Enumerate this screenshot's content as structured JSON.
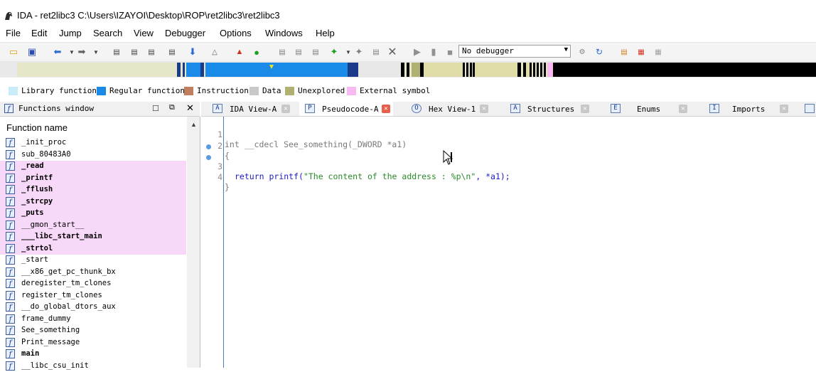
{
  "window": {
    "title": "IDA - ret2libc3 C:\\Users\\IZAYOI\\Desktop\\ROP\\ret2libc3\\ret2libc3"
  },
  "menu": [
    "File",
    "Edit",
    "Jump",
    "Search",
    "View",
    "Debugger",
    "Options",
    "Windows",
    "Help"
  ],
  "toolbar": {
    "debugger": "No debugger"
  },
  "legend": [
    {
      "label": "Library function",
      "color": "#c8ecf8"
    },
    {
      "label": "Regular function",
      "color": "#1a8ae8"
    },
    {
      "label": "Instruction",
      "color": "#c08060"
    },
    {
      "label": "Data",
      "color": "#c8c8c8"
    },
    {
      "label": "Unexplored",
      "color": "#b0b070"
    },
    {
      "label": "External symbol",
      "color": "#f8b8f0"
    }
  ],
  "functions_window": {
    "title": "Functions window",
    "column_header": "Function name",
    "items": [
      {
        "name": "_init_proc",
        "bold": false,
        "external": false
      },
      {
        "name": "sub_80483A0",
        "bold": false,
        "external": false
      },
      {
        "name": "_read",
        "bold": true,
        "external": true
      },
      {
        "name": "_printf",
        "bold": true,
        "external": true
      },
      {
        "name": "_fflush",
        "bold": true,
        "external": true
      },
      {
        "name": "_strcpy",
        "bold": true,
        "external": true
      },
      {
        "name": "_puts",
        "bold": true,
        "external": true
      },
      {
        "name": "__gmon_start__",
        "bold": false,
        "external": true
      },
      {
        "name": "___libc_start_main",
        "bold": true,
        "external": true
      },
      {
        "name": "_strtol",
        "bold": true,
        "external": true
      },
      {
        "name": "_start",
        "bold": false,
        "external": false
      },
      {
        "name": "__x86_get_pc_thunk_bx",
        "bold": false,
        "external": false
      },
      {
        "name": "deregister_tm_clones",
        "bold": false,
        "external": false
      },
      {
        "name": "register_tm_clones",
        "bold": false,
        "external": false
      },
      {
        "name": "__do_global_dtors_aux",
        "bold": false,
        "external": false
      },
      {
        "name": "frame_dummy",
        "bold": false,
        "external": false
      },
      {
        "name": "See_something",
        "bold": false,
        "external": false
      },
      {
        "name": "Print_message",
        "bold": false,
        "external": false
      },
      {
        "name": "main",
        "bold": true,
        "external": false
      },
      {
        "name": "__libc_csu_init",
        "bold": false,
        "external": false
      }
    ]
  },
  "tabs": [
    {
      "label": "IDA View-A",
      "icon": "A"
    },
    {
      "label": "Pseudocode-A",
      "icon": "P"
    },
    {
      "label": "Hex View-1",
      "icon": "O"
    },
    {
      "label": "Structures",
      "icon": "A"
    },
    {
      "label": "Enums",
      "icon": "E"
    },
    {
      "label": "Imports",
      "icon": "I"
    }
  ],
  "code": {
    "line1_num": "1",
    "line1": "int __cdecl See_something(_DWORD *a1)",
    "line2_num": "2",
    "line2": "{",
    "line3_num": "3",
    "line3_kw": "return printf(",
    "line3_str": "\"The content of the address : %p\\n\"",
    "line3_rest": ", *a1);",
    "line4_num": "4",
    "line4": "}"
  }
}
